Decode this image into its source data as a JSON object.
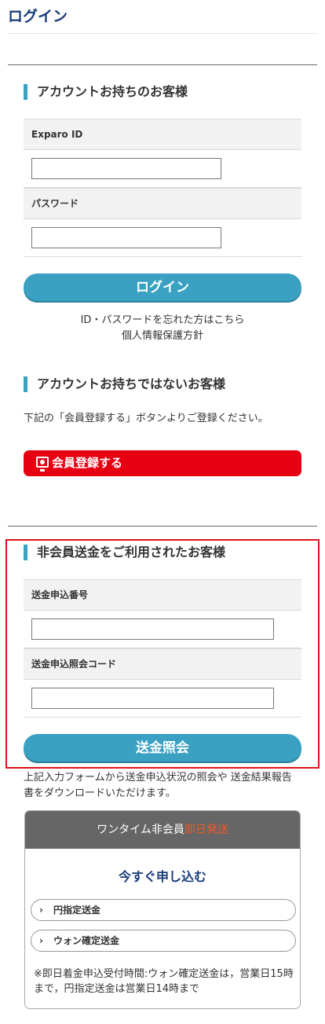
{
  "page": {
    "title": "ログイン"
  },
  "members": {
    "heading": "アカウントお持ちのお客様",
    "id_label": "Exparo ID",
    "id_value": "",
    "password_label": "パスワード",
    "password_value": "",
    "login_button": "ログイン",
    "forgot_link": "ID・パスワードを忘れた方はこちら",
    "privacy_link": "個人情報保護方針"
  },
  "nonmembers": {
    "heading": "アカウントお持ちではないお客様",
    "description": "下記の「会員登録する」ボタンよりご登録ください。",
    "register_button": "会員登録する"
  },
  "guest_transfer": {
    "heading": "非会員送金をご利用されたお客様",
    "number_label": "送金申込番号",
    "number_value": "",
    "code_label": "送金申込照会コード",
    "code_value": "",
    "inquiry_button": "送金照会",
    "description": "上記入力フォームから送金申込状況の照会や 送金結果報告書をダウンロードいただけます。"
  },
  "onetime": {
    "header_prefix": "ワンタイム非会員",
    "header_accent": "即日発送",
    "apply_title": "今すぐ申し込む",
    "options": [
      "円指定送金",
      "ウォン確定送金"
    ],
    "note": "※即日着金申込受付時間:ウォン確定送金は，営業日15時まで，円指定送金は営業日14時まで"
  },
  "colors": {
    "accent": "#3aa1c2",
    "title": "#1a3d7a",
    "danger": "#e60012",
    "highlight": "#f05a28"
  }
}
